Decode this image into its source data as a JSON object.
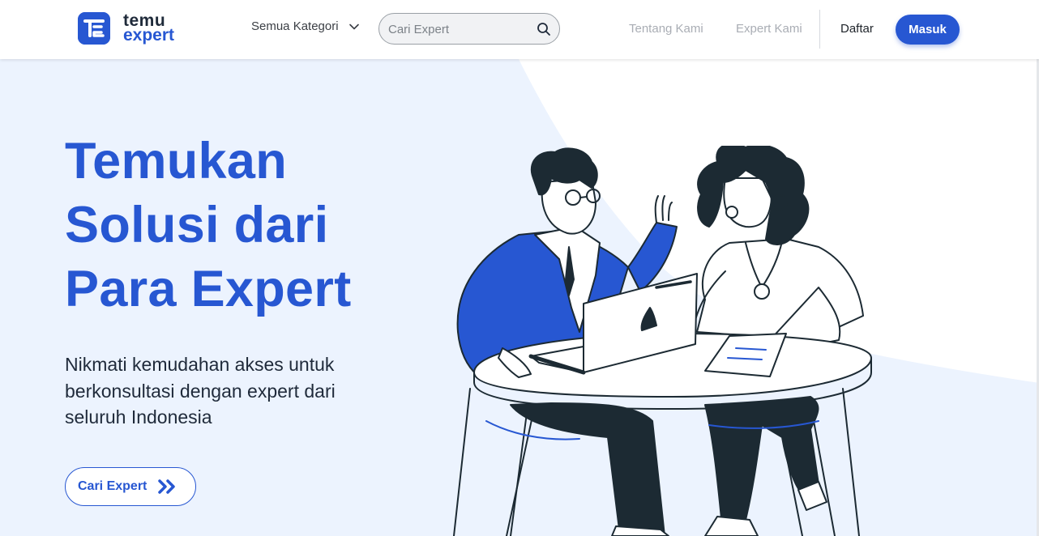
{
  "brand": {
    "line1": "temu",
    "line2": "expert"
  },
  "nav": {
    "category_label": "Semua Kategori",
    "search_placeholder": "Cari Expert",
    "about": "Tentang Kami",
    "experts": "Expert Kami",
    "register": "Daftar",
    "login": "Masuk"
  },
  "hero": {
    "headline": [
      "Temukan",
      "Solusi dari",
      "Para Expert"
    ],
    "subtext": [
      "Nikmati kemudahan akses untuk",
      "berkonsultasi dengan expert dari",
      "seluruh Indonesia"
    ],
    "cta": "Cari Expert"
  },
  "icons": {
    "logo": "temu-expert-logo",
    "dropdown": "chevron-down-icon",
    "search": "search-icon",
    "cta": "double-chevron-right-icon"
  },
  "colors": {
    "primary": "#2757d2",
    "hero_background": "#ecf3fe",
    "text_dark": "#1f2a3a",
    "nav_muted": "#a9adb4"
  }
}
